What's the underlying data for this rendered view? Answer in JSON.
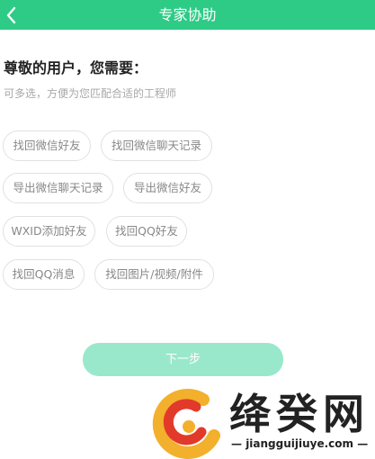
{
  "header": {
    "back_icon": "chevron-left-icon",
    "title": "专家协助",
    "background": "#2ecb86"
  },
  "main": {
    "heading": "尊敬的用户，您需要：",
    "subtitle": "可多选，方便为您匹配合适的工程师",
    "options": [
      {
        "label": "找回微信好友"
      },
      {
        "label": "找回微信聊天记录"
      },
      {
        "label": "导出微信聊天记录"
      },
      {
        "label": "导出微信好友"
      },
      {
        "label": "WXID添加好友"
      },
      {
        "label": "找回QQ好友"
      },
      {
        "label": "找回QQ消息"
      },
      {
        "label": "找回图片/视频/附件"
      }
    ]
  },
  "footer": {
    "next_label": "下一步",
    "next_color": "#9ae8cb"
  },
  "watermark": {
    "name": "绛癸网",
    "domain": "jiangguijiuye.com"
  }
}
